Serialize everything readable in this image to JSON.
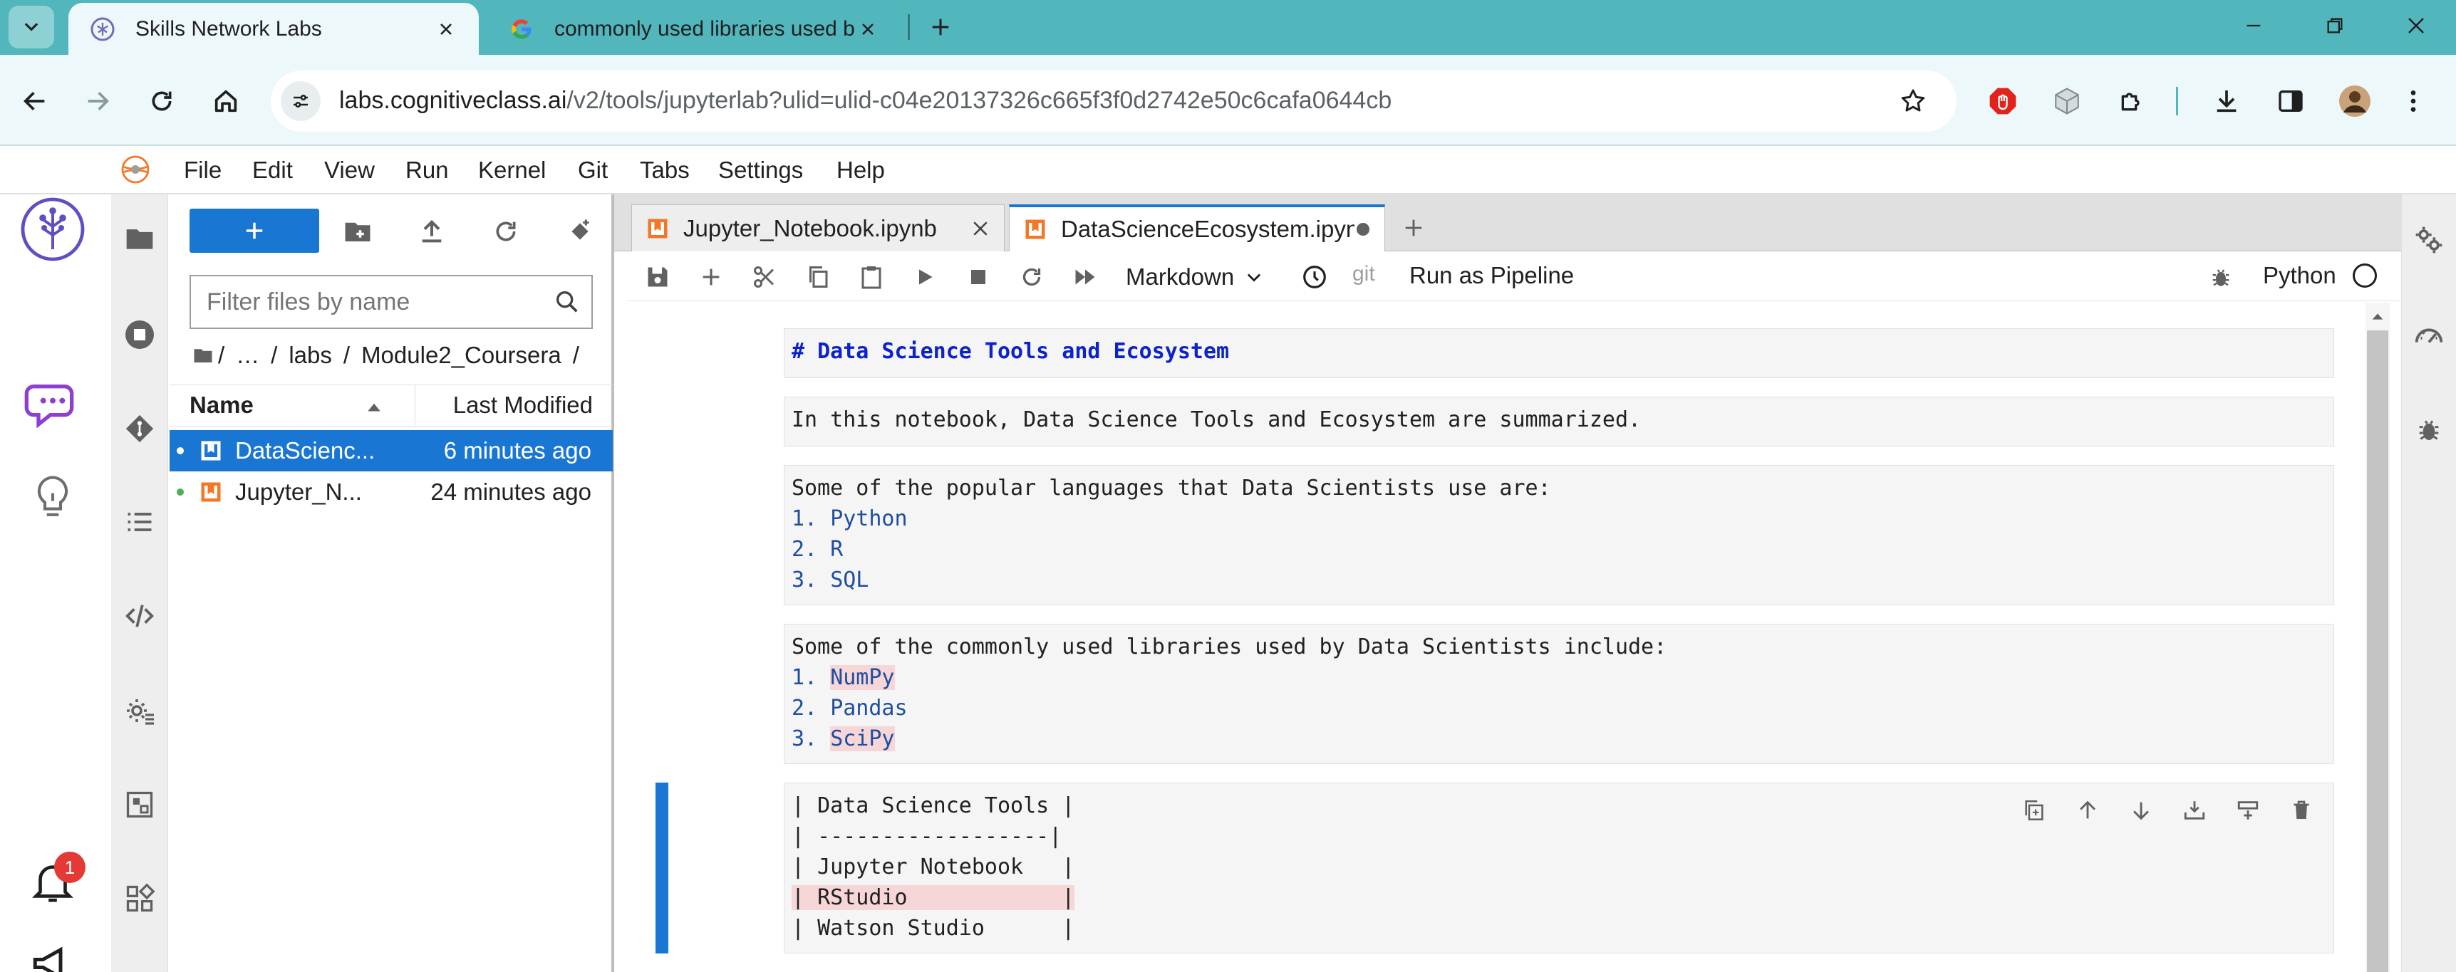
{
  "browser": {
    "tabs": [
      {
        "title": "Skills Network Labs",
        "active": true,
        "favicon": "skills-network-icon"
      },
      {
        "title": "commonly used libraries used by",
        "active": false,
        "favicon": "google-icon"
      }
    ],
    "address": {
      "host": "labs.cognitiveclass.ai",
      "path": "/v2/tools/jupyterlab?ulid=ulid-c04e20137326c665f3f0d2742e50c6cafa0644cb"
    },
    "colors": {
      "tabstrip": "#52b6bd",
      "toolbar": "#ecf8f9"
    }
  },
  "menubar": {
    "items": [
      "File",
      "Edit",
      "View",
      "Run",
      "Kernel",
      "Git",
      "Tabs",
      "Settings",
      "Help"
    ]
  },
  "sidebar": {
    "notification_count": "1",
    "icons": [
      "skills-network-logo",
      "chat-icon",
      "lightbulb-icon",
      "bell-icon",
      "megaphone-icon"
    ]
  },
  "activity_bar": {
    "icons": [
      "folder-icon",
      "stop-circle-icon",
      "git-icon",
      "table-of-contents-icon",
      "code-icon",
      "settings-gear-icon",
      "extension-manager-icon",
      "puzzle-icon"
    ]
  },
  "filebrowser": {
    "filter_placeholder": "Filter files by name",
    "breadcrumbs": [
      "/",
      "…",
      "labs",
      "/",
      "Module2_Coursera",
      "/"
    ],
    "columns": {
      "name": "Name",
      "modified": "Last Modified"
    },
    "files": [
      {
        "name": "DataScienc...",
        "modified": "6 minutes ago",
        "selected": true
      },
      {
        "name": "Jupyter_N...",
        "modified": "24 minutes ago",
        "selected": false
      }
    ]
  },
  "notebook": {
    "tabs": [
      {
        "label": "Jupyter_Notebook.ipynb",
        "active": false
      },
      {
        "label": "DataScienceEcosystem.ipyn",
        "active": true
      }
    ],
    "toolbar": {
      "cell_type": "Markdown",
      "git": "git",
      "run_pipeline": "Run as Pipeline",
      "kernel": "Python"
    },
    "cells": [
      {
        "type": "markdown",
        "lines": [
          "# Data Science Tools and Ecosystem"
        ]
      },
      {
        "type": "markdown",
        "lines": [
          "In this notebook, Data Science Tools and Ecosystem are summarized."
        ]
      },
      {
        "type": "markdown",
        "intro": "Some of the popular languages that Data Scientists use are:",
        "items": [
          {
            "num": "1.",
            "text": "Python"
          },
          {
            "num": "2.",
            "text": "R"
          },
          {
            "num": "3.",
            "text": "SQL"
          }
        ]
      },
      {
        "type": "markdown",
        "intro": "Some of the commonly used libraries used by Data Scientists include:",
        "items": [
          {
            "num": "1.",
            "text": "NumPy"
          },
          {
            "num": "2.",
            "text": "Pandas"
          },
          {
            "num": "3.",
            "text": "SciPy"
          }
        ]
      },
      {
        "type": "markdown",
        "active": true,
        "lines": [
          "| Data Science Tools |",
          "| ------------------|",
          "| Jupyter Notebook   |",
          "| RStudio            |",
          "| Watson Studio      |"
        ]
      }
    ],
    "accent": "#1976d2"
  }
}
